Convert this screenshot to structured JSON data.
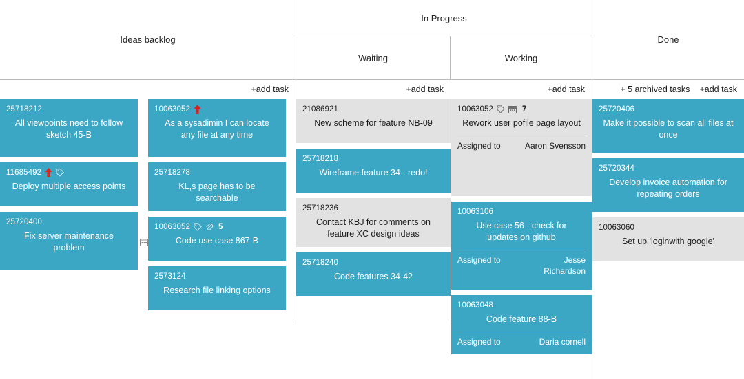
{
  "colors": {
    "card_teal": "#3ba7c4",
    "card_gray": "#e2e2e2",
    "priority_red": "#d9241f",
    "grid_line": "#b9b9b9",
    "text_dark": "#1a1a1a",
    "text_light": "#ffffff"
  },
  "headers": {
    "group_in_progress": "In Progress",
    "ideas_backlog": "Ideas backlog",
    "waiting": "Waiting",
    "working": "Working",
    "done": "Done"
  },
  "actions": {
    "add_task": "+add task",
    "archived_tasks": "+ 5 archived tasks"
  },
  "columns": {
    "backlog": {
      "lane_a": [
        {
          "id": "25718212",
          "title": "All viewpoints need to follow sketch 45-B",
          "style": "teal",
          "icons": [],
          "count": "",
          "size": "h-tall"
        },
        {
          "id": "11685492",
          "title": "Deploy multiple access points",
          "style": "teal",
          "icons": [
            "priority-arrow-icon",
            "tag-icon"
          ],
          "count": "",
          "size": "h-mid"
        },
        {
          "id": "25720400",
          "title": "Fix server maintenance problem",
          "style": "teal",
          "icons": [],
          "count": "",
          "size": "h-tall"
        }
      ],
      "lane_b": [
        {
          "id": "10063052",
          "title": "As a sysadimin I can locate any file at any time",
          "style": "teal",
          "icons": [
            "priority-arrow-icon"
          ],
          "count": "",
          "size": "h-tall"
        },
        {
          "id": "25718278",
          "title": "KL,s page has to be searchable",
          "style": "teal",
          "icons": [],
          "count": "",
          "size": "h-mid"
        },
        {
          "id": "10063052",
          "title": "Code use case 867-B",
          "style": "teal",
          "icons": [
            "tag-icon",
            "paperclip-icon"
          ],
          "count": "5",
          "size": "h-mid"
        },
        {
          "id": "2573124",
          "title": "Research file linking options",
          "style": "teal",
          "icons": [],
          "count": "",
          "size": "h-mid"
        }
      ]
    },
    "waiting": [
      {
        "id": "21086921",
        "title": "New scheme for feature NB-09",
        "style": "gray",
        "icons": [],
        "count": "",
        "size": "h-mid"
      },
      {
        "id": "25718218",
        "title": "Wireframe feature 34 - redo!",
        "style": "teal",
        "icons": [],
        "count": "",
        "size": "h-mid"
      },
      {
        "id": "25718236",
        "title": "Contact KBJ for comments on feature XC design ideas",
        "style": "gray",
        "icons": [],
        "count": "",
        "size": "h-mid"
      },
      {
        "id": "25718240",
        "title": "Code features 34-42",
        "style": "teal",
        "icons": [],
        "count": "",
        "size": "h-mid"
      }
    ],
    "working": [
      {
        "id": "10063052",
        "title": "Rework user pofile page layout",
        "style": "gray",
        "icons": [
          "tag-icon",
          "calendar-icon"
        ],
        "count": "7",
        "size": "h-work1",
        "assigned_label": "Assigned to",
        "assignee": "Aaron Svensson"
      },
      {
        "id": "10063106",
        "title": "Use case 56 - check for updates on github",
        "style": "teal",
        "icons": [],
        "count": "",
        "size": "h-work2",
        "assigned_label": "Assigned to",
        "assignee": "Jesse Richardson"
      },
      {
        "id": "10063048",
        "title": "Code feature 88-B",
        "style": "teal",
        "icons": [],
        "count": "",
        "size": "h-work3",
        "assigned_label": "Assigned to",
        "assignee": "Daria cornell"
      }
    ],
    "done": [
      {
        "id": "25720406",
        "title": "Make it possible to scan all files at once",
        "style": "teal",
        "icons": [],
        "count": "",
        "size": "h-done1"
      },
      {
        "id": "25720344",
        "title": "Develop invoice automation for repeating orders",
        "style": "teal",
        "icons": [],
        "count": "",
        "size": "h-done2"
      },
      {
        "id": "10063060",
        "title": "Set up 'loginwith google'",
        "style": "gray",
        "icons": [],
        "count": "",
        "size": "h-mid"
      }
    ]
  }
}
